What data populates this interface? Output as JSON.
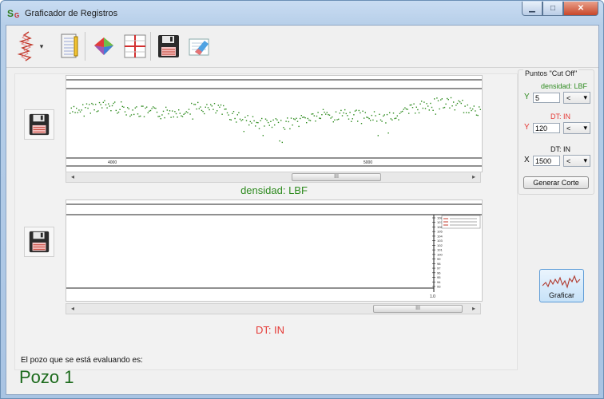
{
  "window": {
    "title": "Graficador de Registros",
    "icon_letters": "S",
    "icon_sub": "G"
  },
  "window_controls": {
    "minimize": "▁",
    "maximize": "□",
    "close": "✕"
  },
  "toolbar": {
    "tools": [
      "log-curve-icon",
      "document-icon",
      "surface-3d-icon",
      "cross-chart-icon",
      "save-disk-icon",
      "eraser-icon"
    ],
    "dropdown_glyph": "▾"
  },
  "chart1": {
    "caption": "densidad: LBF",
    "caption_color": "#2e8b1f",
    "x_ticks": [
      "4000",
      "5000"
    ],
    "scroll_thumb": "III"
  },
  "chart2": {
    "caption": "DT: IN",
    "caption_color": "#e53935",
    "y_ticks": [
      "108",
      "107",
      "106",
      "105",
      "104",
      "103",
      "102",
      "101",
      "100",
      "99",
      "98",
      "97",
      "96",
      "95",
      "94",
      "93"
    ],
    "x_tick": "1.0",
    "scroll_thumb": "III"
  },
  "cutoff": {
    "legend": "Puntos \"Cut Off\"",
    "rows": [
      {
        "label": "densidad: LBF",
        "label_color": "#2e8b1f",
        "axis": "Y",
        "axis_color": "#2e8b1f",
        "value": "5",
        "op": "<"
      },
      {
        "label": "DT: IN",
        "label_color": "#e53935",
        "axis": "Y",
        "axis_color": "#e53935",
        "value": "120",
        "op": "<"
      },
      {
        "label": "DT: IN",
        "label_color": "#111111",
        "axis": "X",
        "axis_color": "#111111",
        "value": "1500",
        "op": "<"
      }
    ],
    "generate_label": "Generar Corte"
  },
  "graficar": {
    "label": "Graficar"
  },
  "footer": {
    "caption": "El pozo que se está evaluando es:",
    "well": "Pozo 1"
  }
}
